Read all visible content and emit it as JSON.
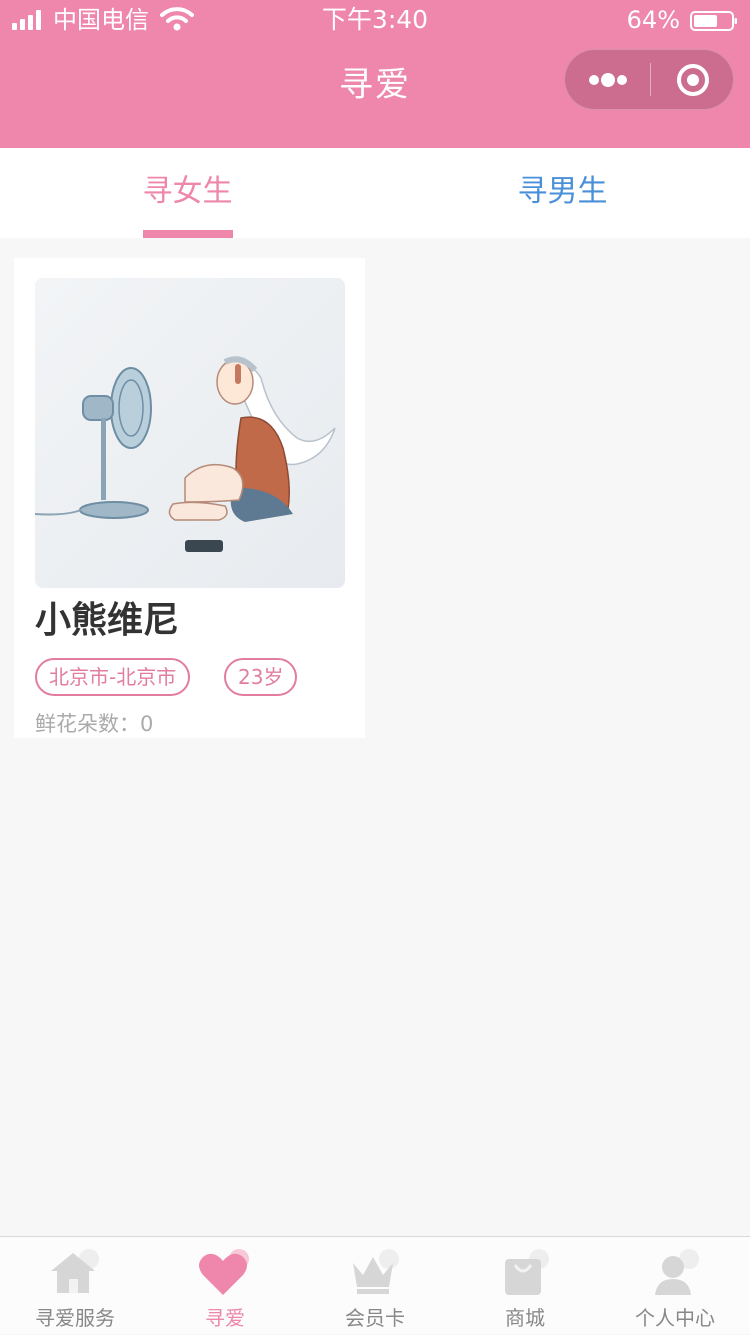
{
  "status_bar": {
    "carrier": "中国电信",
    "time": "下午3:40",
    "battery": "64%",
    "battery_level": 0.64
  },
  "nav": {
    "title": "寻爱"
  },
  "tabs": [
    {
      "label": "寻女生",
      "active": true
    },
    {
      "label": "寻男生",
      "active": false
    }
  ],
  "profiles": [
    {
      "name": "小熊维尼",
      "location": "北京市-北京市",
      "age": "23岁",
      "flowers_label": "鲜花朵数：",
      "flowers": "0"
    }
  ],
  "tabbar": [
    {
      "label": "寻爱服务",
      "icon": "home-icon",
      "active": false
    },
    {
      "label": "寻爱",
      "icon": "heart-icon",
      "active": true
    },
    {
      "label": "会员卡",
      "icon": "crown-icon",
      "active": false
    },
    {
      "label": "商城",
      "icon": "shopping-bag-icon",
      "active": false
    },
    {
      "label": "个人中心",
      "icon": "user-icon",
      "active": false
    }
  ],
  "colors": {
    "brand": "#ee87ab",
    "tab_inactive": "#4a90d9",
    "background": "#f7f7f7",
    "tabbar_inactive": "#888888"
  }
}
